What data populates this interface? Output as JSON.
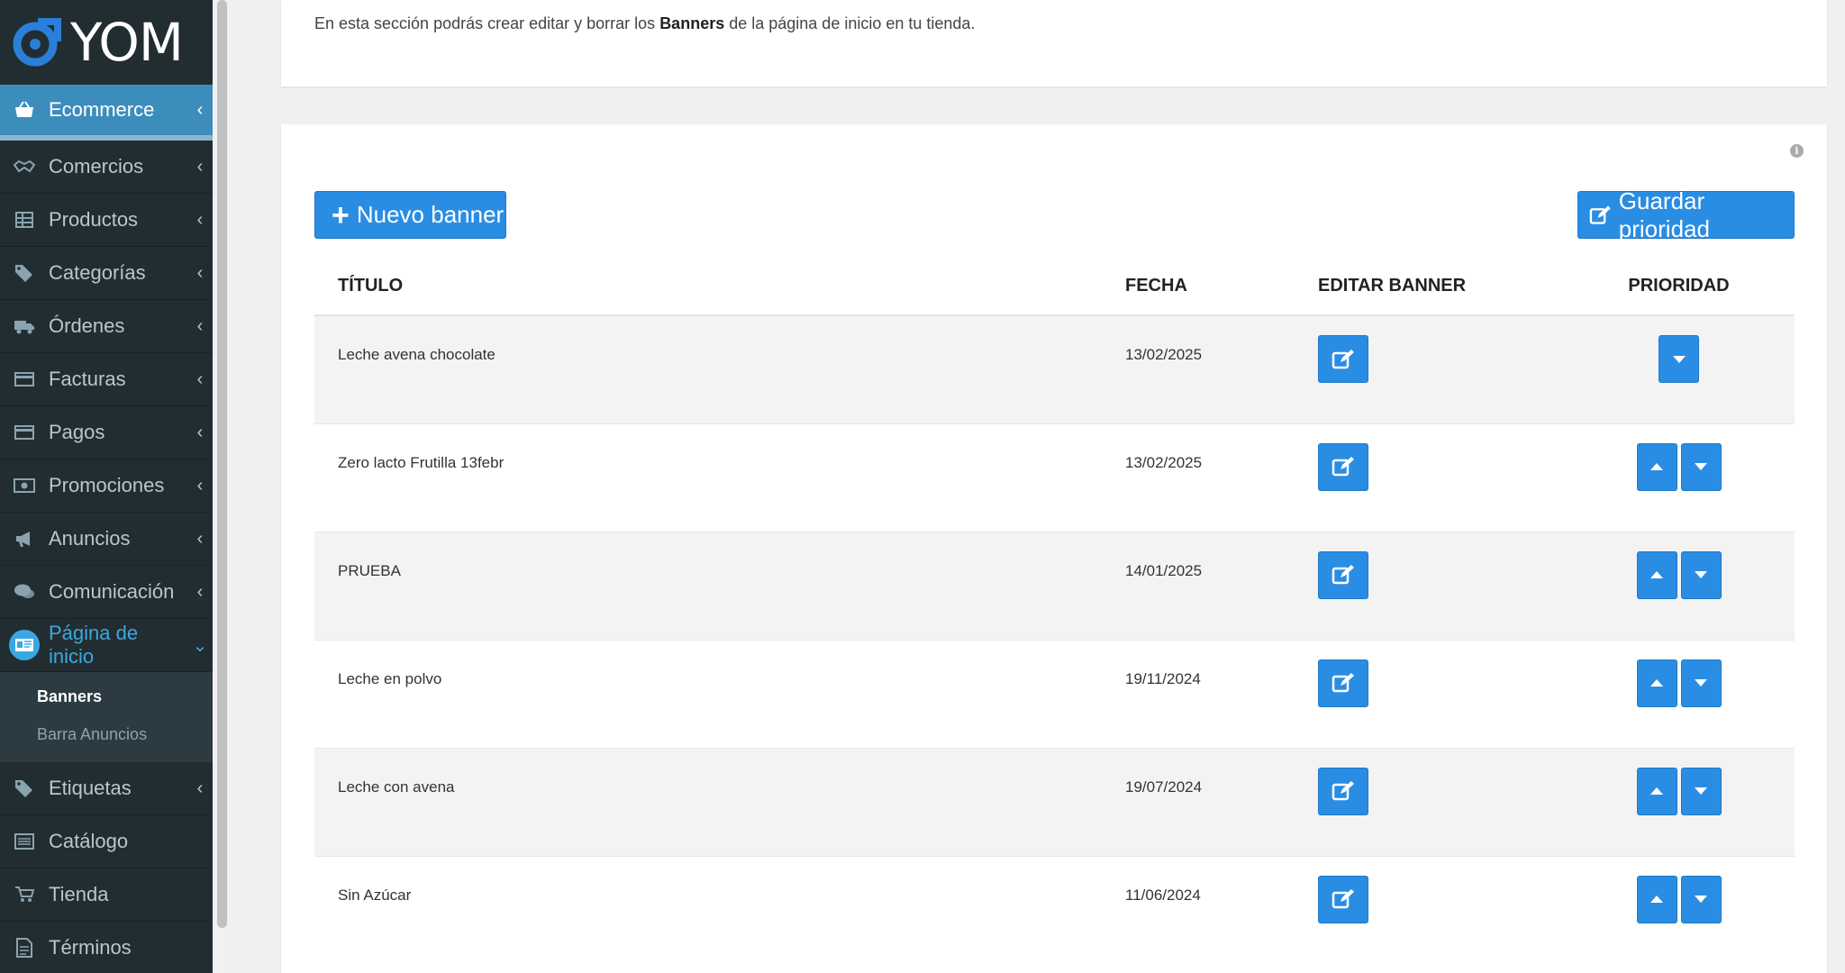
{
  "brand": {
    "name": "YOM"
  },
  "sidebar": {
    "items": [
      {
        "label": "Ecommerce",
        "icon": "basket-icon"
      },
      {
        "label": "Comercios",
        "icon": "handshake-icon"
      },
      {
        "label": "Productos",
        "icon": "table-icon"
      },
      {
        "label": "Categorías",
        "icon": "tags-icon"
      },
      {
        "label": "Órdenes",
        "icon": "truck-icon"
      },
      {
        "label": "Facturas",
        "icon": "credit-card-icon"
      },
      {
        "label": "Pagos",
        "icon": "credit-card-icon"
      },
      {
        "label": "Promociones",
        "icon": "money-icon"
      },
      {
        "label": "Anuncios",
        "icon": "bullhorn-icon"
      },
      {
        "label": "Comunicación",
        "icon": "comments-icon"
      },
      {
        "label": "Página de inicio",
        "icon": "id-card-icon"
      },
      {
        "label": "Etiquetas",
        "icon": "tag-icon"
      },
      {
        "label": "Catálogo",
        "icon": "list-icon"
      },
      {
        "label": "Tienda",
        "icon": "cart-icon"
      },
      {
        "label": "Términos",
        "icon": "file-icon"
      }
    ],
    "submenu": [
      "Banners",
      "Barra Anuncios"
    ]
  },
  "intro": {
    "before": "En esta sección podrás crear editar y borrar los ",
    "bold": "Banners",
    "after": " de la página de inicio en tu tienda."
  },
  "toolbar": {
    "new_label": "Nuevo banner",
    "save_label": "Guardar prioridad",
    "info": "i"
  },
  "table": {
    "headers": {
      "title": "TÍTULO",
      "date": "FECHA",
      "edit": "EDITAR BANNER",
      "priority": "PRIORIDAD"
    },
    "rows": [
      {
        "title": "Leche avena chocolate",
        "date": "13/02/2025"
      },
      {
        "title": "Zero lacto Frutilla 13febr",
        "date": "13/02/2025"
      },
      {
        "title": "PRUEBA",
        "date": "14/01/2025"
      },
      {
        "title": "Leche en polvo",
        "date": "19/11/2024"
      },
      {
        "title": "Leche con avena",
        "date": "19/07/2024"
      },
      {
        "title": "Sin Azúcar",
        "date": "11/06/2024"
      }
    ]
  },
  "colors": {
    "primary": "#2a8de4",
    "sidebar_bg": "#222d32",
    "active": "#3c8dbc",
    "open_link": "#3aa8e0"
  }
}
